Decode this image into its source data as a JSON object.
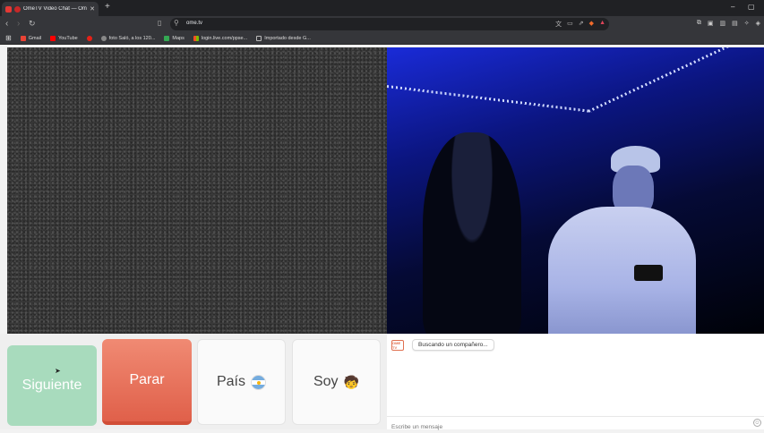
{
  "browser": {
    "tab_title": "OmeTV Video Chat — Omegle",
    "tab_close": "✕",
    "new_tab": "+",
    "url": "ome.tv",
    "window": {
      "minimize": "–",
      "maximize": "▢"
    }
  },
  "bookmarks": [
    {
      "label": "Gmail",
      "color": "#ea4335"
    },
    {
      "label": "YouTube",
      "color": "#ff0000"
    },
    {
      "label": "",
      "color": "#e62117"
    },
    {
      "label": "foto Saló, a los 120...",
      "color": "#888888"
    },
    {
      "label": "Maps",
      "color": "#34a853"
    },
    {
      "label": "login.live.com/ppse...",
      "color": "#f25022"
    },
    {
      "label": "Importado desde G...",
      "color": "#bbbbbb"
    }
  ],
  "controls": {
    "next_label": "Siguiente",
    "stop_label": "Parar",
    "country_label": "País",
    "soy_label": "Soy",
    "soy_emoji": "🧒"
  },
  "chat": {
    "logo_text": "OME TV",
    "status_message": "Buscando un compañero...",
    "input_placeholder": "Escribe un mensaje",
    "emoji_icon": "☺"
  },
  "colors": {
    "next_button": "#a8dbbd",
    "stop_button": "#e8705a",
    "remote_video_tint": "#1a2bd8"
  }
}
